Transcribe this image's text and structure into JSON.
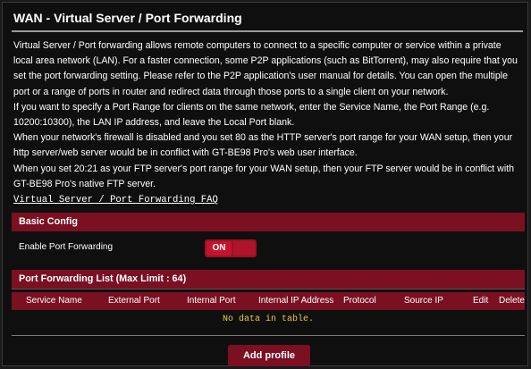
{
  "page": {
    "title": "WAN - Virtual Server / Port Forwarding"
  },
  "description": {
    "paragraphs": [
      "Virtual Server / Port forwarding allows remote computers to connect to a specific computer or service within a private local area network (LAN). For a faster connection, some P2P applications (such as BitTorrent), may also require that you set the port forwarding setting. Please refer to the P2P application's user manual for details. You can open the multiple port or a range of ports in router and redirect data through those ports to a single client on your network.",
      "If you want to specify a Port Range for clients on the same network, enter the Service Name, the Port Range (e.g. 10200:10300), the LAN IP address, and leave the Local Port blank.",
      "When your network's firewall is disabled and you set 80 as the HTTP server's port range for your WAN setup, then your http server/web server would be in conflict with GT-BE98 Pro's web user interface.",
      "When you set 20:21 as your FTP server's port range for your WAN setup, then your FTP server would be in conflict with GT-BE98 Pro's native FTP server."
    ],
    "faq_link": "Virtual Server / Port Forwarding FAQ"
  },
  "basic_config": {
    "header": "Basic Config",
    "enable_label": "Enable Port Forwarding",
    "toggle_state": "ON"
  },
  "port_forwarding_list": {
    "header": "Port Forwarding List (Max Limit : 64)",
    "columns": {
      "service_name": "Service Name",
      "external_port": "External Port",
      "internal_port": "Internal Port",
      "internal_ip": "Internal IP Address",
      "protocol": "Protocol",
      "source_ip": "Source IP",
      "edit": "Edit",
      "delete": "Delete"
    },
    "empty_message": "No data in table."
  },
  "actions": {
    "add_profile": "Add profile"
  },
  "colors": {
    "accent": "#7a1022",
    "toggle_on": "#c4132e",
    "empty_text": "#e7c94a",
    "background": "#0f0f0f"
  }
}
